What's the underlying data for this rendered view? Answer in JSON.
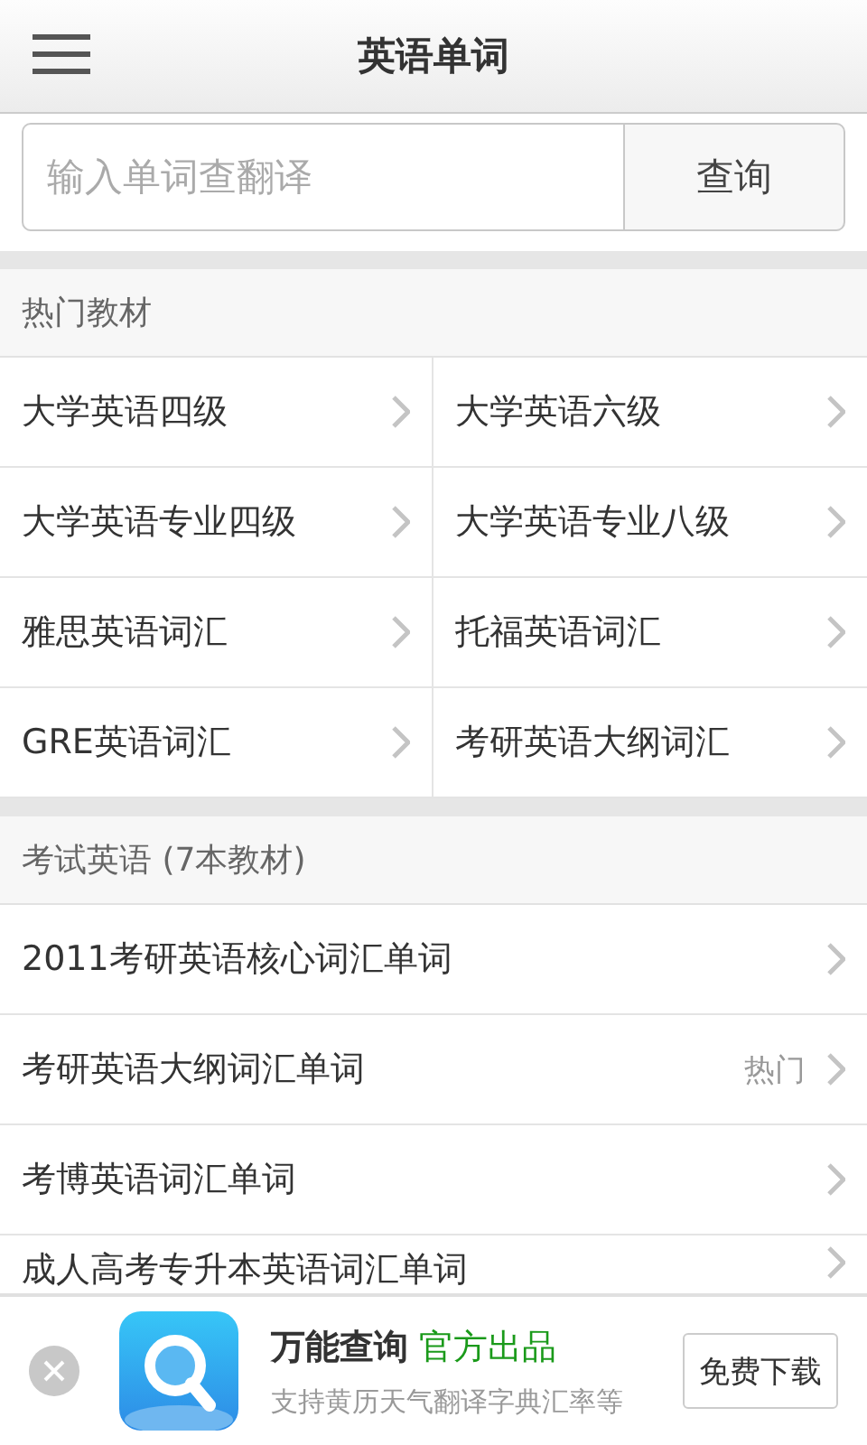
{
  "header": {
    "title": "英语单词"
  },
  "search": {
    "placeholder": "输入单词查翻译",
    "button": "查询"
  },
  "sections": [
    {
      "kind": "grid",
      "title": "热门教材",
      "items": [
        {
          "label": "大学英语四级"
        },
        {
          "label": "大学英语六级"
        },
        {
          "label": "大学英语专业四级"
        },
        {
          "label": "大学英语专业八级"
        },
        {
          "label": "雅思英语词汇"
        },
        {
          "label": "托福英语词汇"
        },
        {
          "label": "GRE英语词汇"
        },
        {
          "label": "考研英语大纲词汇"
        }
      ]
    },
    {
      "kind": "list",
      "title": "考试英语 (7本教材)",
      "items": [
        {
          "label": "2011考研英语核心词汇单词"
        },
        {
          "label": "考研英语大纲词汇单词",
          "badge": "热门"
        },
        {
          "label": "考博英语词汇单词"
        },
        {
          "label": "成人高考专升本英语词汇单词"
        }
      ]
    }
  ],
  "ad": {
    "title": "万能查询",
    "tag": "官方出品",
    "subtitle": "支持黄历天气翻译字典汇率等",
    "button": "免费下载"
  }
}
